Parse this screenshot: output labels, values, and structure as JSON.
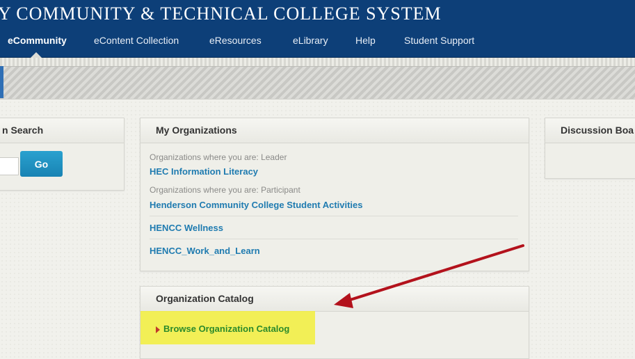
{
  "banner": {
    "title": "Y COMMUNITY & TECHNICAL COLLEGE SYSTEM"
  },
  "nav": {
    "items": [
      {
        "label": "eCommunity",
        "active": true
      },
      {
        "label": "eContent Collection"
      },
      {
        "label": "eResources"
      },
      {
        "label": "eLibrary"
      },
      {
        "label": "Help"
      },
      {
        "label": "Student Support"
      }
    ]
  },
  "search_panel": {
    "title": "n Search",
    "go_label": "Go"
  },
  "my_organizations": {
    "title": "My Organizations",
    "leader_caption": "Organizations where you are: Leader",
    "participant_caption": "Organizations where you are: Participant",
    "leader_orgs": [
      "HEC Information Literacy"
    ],
    "participant_orgs": [
      "Henderson Community College Student Activities",
      "HENCC Wellness",
      "HENCC_Work_and_Learn"
    ]
  },
  "catalog": {
    "title": "Organization Catalog",
    "browse_label": "Browse Organization Catalog"
  },
  "discussion": {
    "title": "Discussion Boa"
  },
  "colors": {
    "header_blue": "#0d3f78",
    "link_blue": "#1f7bb0",
    "go_button": "#1f93c4",
    "highlight_yellow": "#f2ef3c",
    "annotation_red": "#b3121c"
  }
}
